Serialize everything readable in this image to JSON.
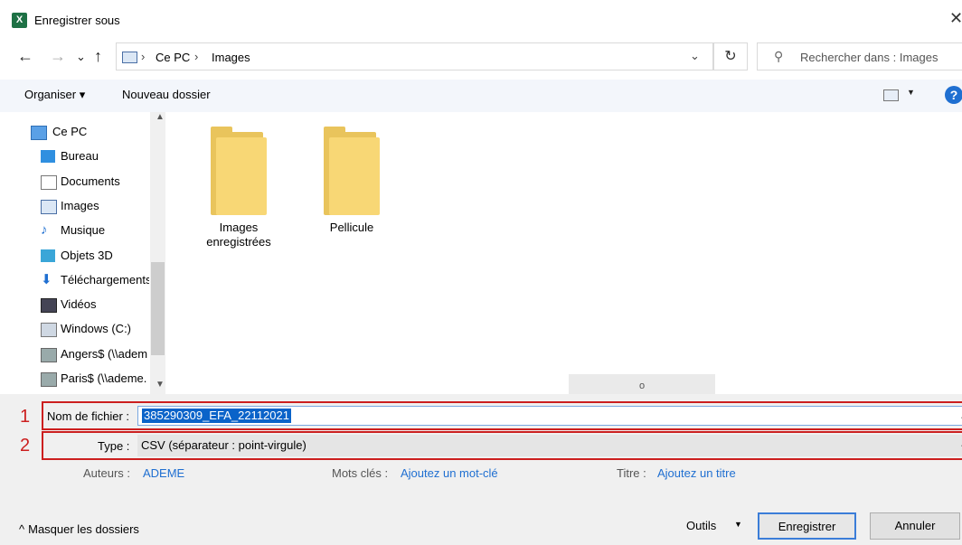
{
  "window": {
    "title": "Enregistrer sous",
    "app_icon_letter": "X"
  },
  "nav_buttons": {
    "back": "←",
    "forward": "→",
    "recent": "⌄",
    "up": "↑"
  },
  "address": {
    "crumbs": [
      "Ce PC",
      "Images"
    ],
    "separator": "›",
    "dropdown": "⌄",
    "refresh": "↻"
  },
  "search": {
    "placeholder": "Rechercher dans : Images"
  },
  "toolbar": {
    "organise": "Organiser ▾",
    "new_folder": "Nouveau dossier",
    "help": "?"
  },
  "sidebar": {
    "items": [
      {
        "label": "Ce PC",
        "icon": "pc-icon"
      },
      {
        "label": "Bureau",
        "icon": "desktop-icon"
      },
      {
        "label": "Documents",
        "icon": "documents-icon"
      },
      {
        "label": "Images",
        "icon": "images-icon"
      },
      {
        "label": "Musique",
        "icon": "music-icon"
      },
      {
        "label": "Objets 3D",
        "icon": "objects-3d-icon"
      },
      {
        "label": "Téléchargements",
        "icon": "downloads-icon"
      },
      {
        "label": "Vidéos",
        "icon": "videos-icon"
      },
      {
        "label": "Windows (C:)",
        "icon": "drive-icon"
      },
      {
        "label": "Angers$ (\\\\adem",
        "icon": "network-drive-disconnected-icon"
      },
      {
        "label": "Paris$ (\\\\ademe.",
        "icon": "network-drive-disconnected-icon"
      }
    ]
  },
  "folders": [
    {
      "label": "Images enregistrées"
    },
    {
      "label": "Pellicule"
    }
  ],
  "hscroll_label": "o",
  "form": {
    "filename_label": "Nom de fichier :",
    "filename_value": "385290309_EFA_22112021",
    "type_label": "Type :",
    "type_value": "CSV (séparateur : point-virgule)",
    "marker_1": "1",
    "marker_2": "2"
  },
  "metadata": {
    "authors_label": "Auteurs :",
    "authors_value": "ADEME",
    "keywords_label": "Mots clés :",
    "keywords_value": "Ajoutez un mot-clé",
    "title_label": "Titre :",
    "title_value": "Ajoutez un titre"
  },
  "footer": {
    "hide_folders": "Masquer les dossiers",
    "tools": "Outils",
    "save": "Enregistrer",
    "cancel": "Annuler"
  },
  "colors": {
    "accent": "#1f6fd1",
    "highlight_box": "#cc1f1f",
    "folder": "#f8d775"
  }
}
